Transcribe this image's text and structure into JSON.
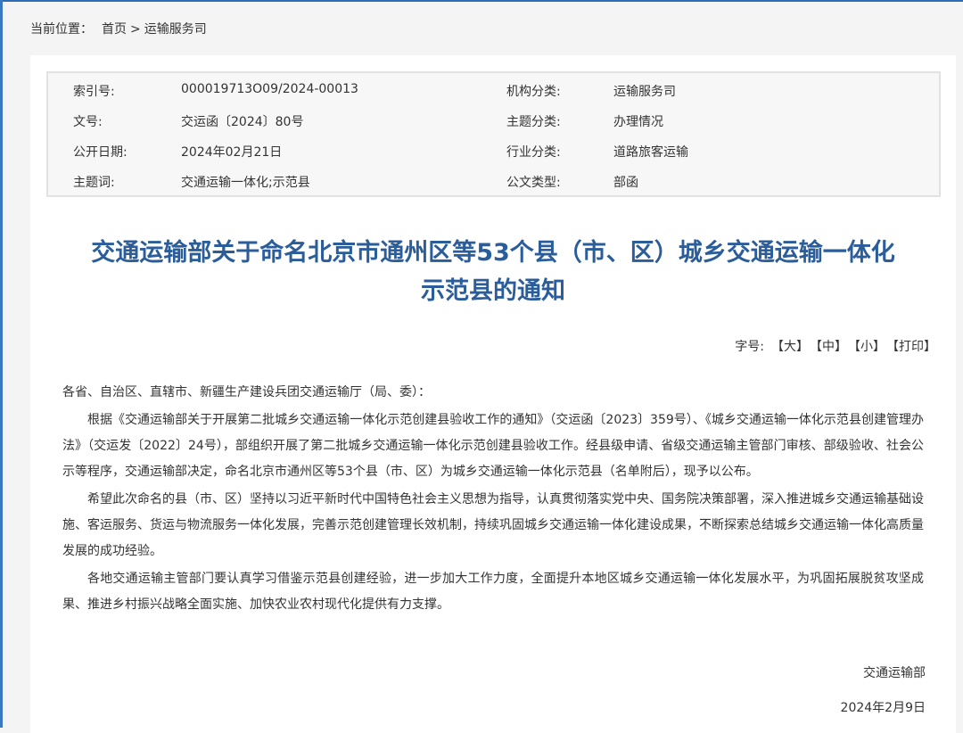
{
  "breadcrumb": {
    "lead": "当前位置：",
    "home": "首页",
    "sep": ">",
    "current": "运输服务司"
  },
  "meta": {
    "index_label": "索引号:",
    "index_value": "000019713O09/2024-00013",
    "org_label": "机构分类:",
    "org_value": "运输服务司",
    "docno_label": "文号:",
    "docno_value": "交运函〔2024〕80号",
    "topic_label": "主题分类:",
    "topic_value": "办理情况",
    "date_label": "公开日期:",
    "date_value": "2024年02月21日",
    "industry_label": "行业分类:",
    "industry_value": "道路旅客运输",
    "keyword_label": "主题词:",
    "keyword_value": "交通运输一体化;示范县",
    "doctype_label": "公文类型:",
    "doctype_value": "部函"
  },
  "title": {
    "line1": "交通运输部关于命名北京市通州区等53个县（市、区）城乡交通运输一体化",
    "line2": "示范县的通知"
  },
  "font_controls": {
    "label": "字号:",
    "large": "【大】",
    "medium": "【中】",
    "small": "【小】",
    "print": "【打印】"
  },
  "body": {
    "salutation": "各省、自治区、直辖市、新疆生产建设兵团交通运输厅（局、委）：",
    "p1": "根据《交通运输部关于开展第二批城乡交通运输一体化示范创建县验收工作的通知》（交运函〔2023〕359号）、《城乡交通运输一体化示范县创建管理办法》（交运发〔2022〕24号），部组织开展了第二批城乡交通运输一体化示范创建县验收工作。经县级申请、省级交通运输主管部门审核、部级验收、社会公示等程序，交通运输部决定，命名北京市通州区等53个县（市、区）为城乡交通运输一体化示范县（名单附后），现予以公布。",
    "p2": "希望此次命名的县（市、区）坚持以习近平新时代中国特色社会主义思想为指导，认真贯彻落实党中央、国务院决策部署，深入推进城乡交通运输基础设施、客运服务、货运与物流服务一体化发展，完善示范创建管理长效机制，持续巩固城乡交通运输一体化建设成果，不断探索总结城乡交通运输一体化高质量发展的成功经验。",
    "p3": "各地交通运输主管部门要认真学习借鉴示范县创建经验，进一步加大工作力度，全面提升本地区城乡交通运输一体化发展水平，为巩固拓展脱贫攻坚成果、推进乡村振兴战略全面实施、加快农业农村现代化提供有力支撑。"
  },
  "signature": {
    "org": "交通运输部",
    "date": "2024年2月9日"
  }
}
